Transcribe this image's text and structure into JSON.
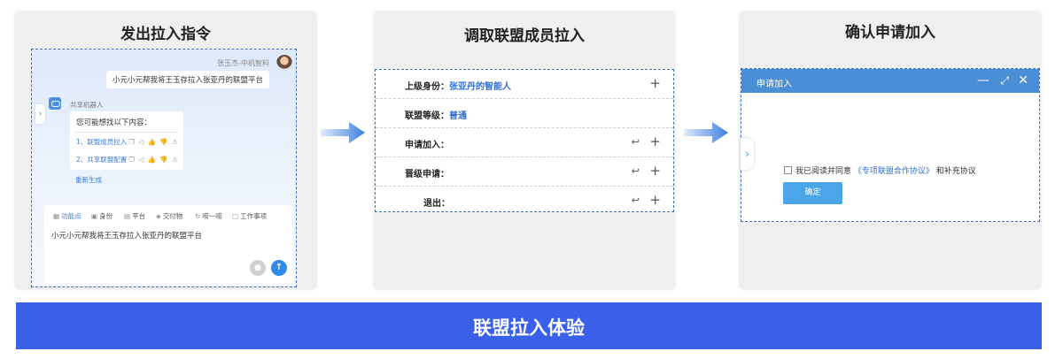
{
  "panels": {
    "step1": {
      "title": "发出拉入指令",
      "chat": {
        "sender_name": "张玉杰-中机智料",
        "user_message": "小元小元帮我将王玉存拉入张亚丹的联盟平台",
        "bot_name": "共享机器人",
        "bot_prompt": "您可能想找以下内容：",
        "suggestions": [
          "1、联盟成员拉入",
          "2、共享联盟配置"
        ],
        "regenerate": "重新生成",
        "toolbar": [
          "功能点",
          "身份",
          "平台",
          "交付物",
          "唠一唠",
          "工作事项"
        ],
        "input_text": "小元小元帮我将王玉存拉入张亚丹的联盟平台"
      }
    },
    "step2": {
      "title": "调取联盟成员拉入",
      "rows": [
        {
          "label": "上级身份：",
          "value": "张亚丹的智能人"
        },
        {
          "label": "联盟等级：",
          "value": "普通"
        },
        {
          "label": "申请加入：",
          "value": ""
        },
        {
          "label": "晋级申请：",
          "value": ""
        },
        {
          "label": "退出：",
          "value": ""
        }
      ]
    },
    "step3": {
      "title": "确认申请加入",
      "dialog": {
        "title": "申请加入",
        "agree_prefix": "我已阅读并同意",
        "agree_link": "《专项联盟合作协议》",
        "agree_suffix": "和补充协议",
        "confirm": "确定"
      }
    }
  },
  "banner": "联盟拉入体验",
  "colors": {
    "accent": "#3a60ea",
    "link": "#2f6fd0",
    "dialog_header": "#4a8fd6",
    "arrow": "#3b7fe0"
  }
}
